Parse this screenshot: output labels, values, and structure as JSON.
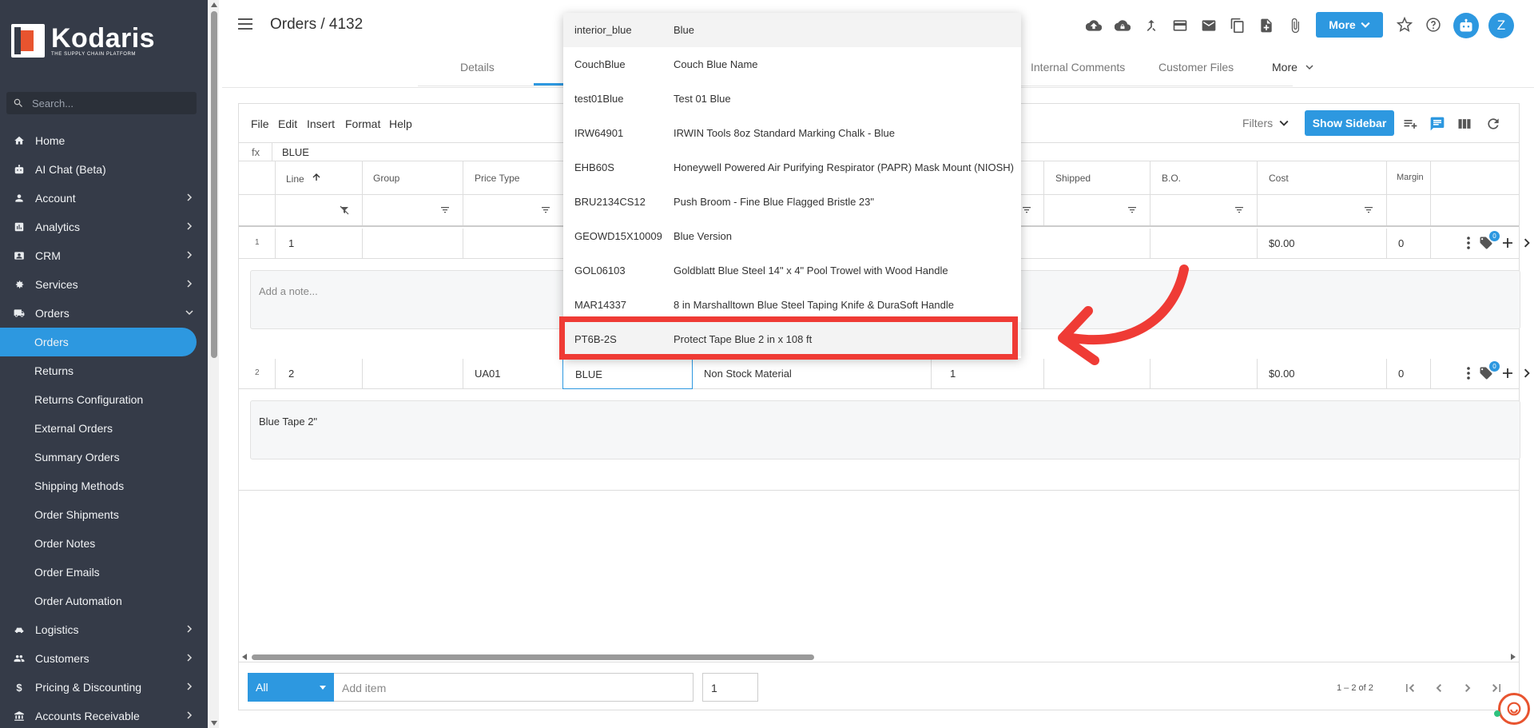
{
  "brand": {
    "name": "Kodaris",
    "tagline": "THE SUPPLY CHAIN PLATFORM",
    "accent": "#2d98e0",
    "logo_color": "#e8542f"
  },
  "sidebar": {
    "search_placeholder": "Search...",
    "items": [
      {
        "label": "Home",
        "icon": "home-icon"
      },
      {
        "label": "AI Chat (Beta)",
        "icon": "robot-icon"
      },
      {
        "label": "Account",
        "icon": "person-icon",
        "chevron": true
      },
      {
        "label": "Analytics",
        "icon": "chart-icon",
        "chevron": true
      },
      {
        "label": "CRM",
        "icon": "contact-icon",
        "chevron": true
      },
      {
        "label": "Services",
        "icon": "services-icon",
        "chevron": true
      },
      {
        "label": "Orders",
        "icon": "truck-icon",
        "chevron": true,
        "expanded": true
      }
    ],
    "sub_items": [
      "Orders",
      "Returns",
      "Returns Configuration",
      "External Orders",
      "Summary Orders",
      "Shipping Methods",
      "Order Shipments",
      "Order Notes",
      "Order Emails",
      "Order Automation"
    ],
    "active_sub": "Orders",
    "bottom_items": [
      {
        "label": "Logistics",
        "icon": "logistics-icon"
      },
      {
        "label": "Customers",
        "icon": "people-icon"
      },
      {
        "label": "Pricing & Discounting",
        "icon": "dollar-icon"
      },
      {
        "label": "Accounts Receivable",
        "icon": "bank-icon"
      }
    ]
  },
  "header": {
    "title": "Orders / 4132",
    "tabs": [
      "Details",
      "Internal Comments",
      "Customer Files",
      "More"
    ],
    "more_label": "More",
    "avatar_initial": "Z"
  },
  "toolbar": {
    "menus": [
      "File",
      "Edit",
      "Insert",
      "Format",
      "Help"
    ],
    "filters_label": "Filters",
    "show_sidebar_label": "Show Sidebar"
  },
  "formula_bar": {
    "fx": "fx",
    "value": "BLUE"
  },
  "grid": {
    "columns": [
      "Line",
      "Group",
      "Price Type",
      "Shipped",
      "B.O.",
      "Cost",
      "Margin"
    ],
    "rows": [
      {
        "num": "1",
        "line": "1",
        "price_type": "",
        "item": "",
        "description": "",
        "qty": "",
        "cost": "$0.00",
        "margin": "0",
        "note": "Add a note...",
        "tag_count": "0"
      },
      {
        "num": "2",
        "line": "2",
        "price_type": "UA01",
        "item": "BLUE",
        "description": "Non Stock Material",
        "qty": "1",
        "cost": "$0.00",
        "margin": "0",
        "note": "Blue Tape 2\"",
        "tag_count": "0"
      }
    ]
  },
  "footer": {
    "type_select": "All",
    "add_item_placeholder": "Add item",
    "qty": "1",
    "range": "1 – 2 of 2"
  },
  "dropdown": {
    "items": [
      {
        "code": "interior_blue",
        "name": "Blue"
      },
      {
        "code": "CouchBlue",
        "name": "Couch Blue Name"
      },
      {
        "code": "test01Blue",
        "name": "Test 01 Blue"
      },
      {
        "code": "IRW64901",
        "name": "IRWIN Tools 8oz Standard Marking Chalk - Blue"
      },
      {
        "code": "EHB60S",
        "name": "Honeywell Powered Air Purifying Respirator (PAPR) Mask Mount (NIOSH)"
      },
      {
        "code": "BRU2134CS12",
        "name": "Push Broom - Fine Blue Flagged Bristle 23\""
      },
      {
        "code": "GEOWD15X10009",
        "name": "Blue Version"
      },
      {
        "code": "GOL06103",
        "name": "Goldblatt Blue Steel 14\" x 4\" Pool Trowel with Wood Handle"
      },
      {
        "code": "MAR14337",
        "name": "8 in Marshalltown Blue Steel Taping Knife & DuraSoft Handle"
      },
      {
        "code": "PT6B-2S",
        "name": "Protect Tape Blue 2 in x 108 ft"
      }
    ],
    "highlighted_index": 9,
    "highlight_color": "#ef3b35"
  }
}
